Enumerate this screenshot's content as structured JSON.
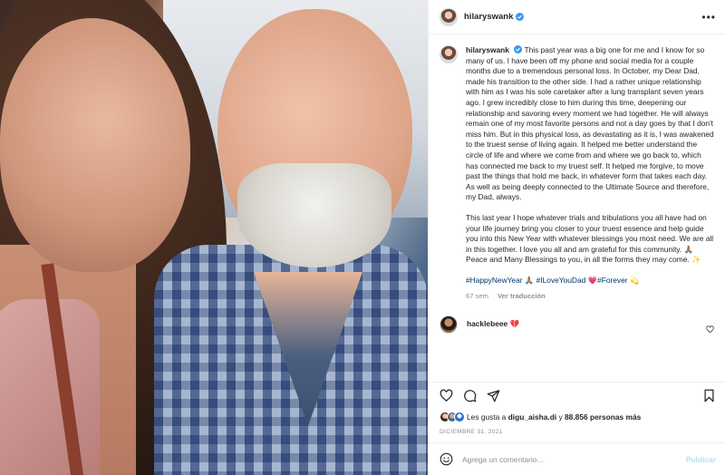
{
  "post": {
    "username": "hilaryswank",
    "more_label": "•••",
    "caption_paragraphs": [
      "This past year was a big one for me and I know for so many of us. I have been off my phone and social media for a couple months due to a tremendous personal loss. In October, my Dear Dad, made his transition to the other side. I had a rather unique relationship with him as I was his sole caretaker after a lung transplant seven years ago. I grew incredibly close to him during this time, deepening our relationship and savoring every moment we had together. He will always remain one of my most favorite persons and not a day goes by that I don't miss him. But in this physical loss, as devastating as it is, I was awakened to the truest sense of living again. It helped me better understand the circle of life and where we come from and where we go back to, which has connected me back to my truest self. It helped me forgive, to move past the things that hold me back, in whatever form that takes each day. As well as being deeply connected to the Ultimate Source and therefore, my Dad, always.",
      "This last year I hope whatever trials and tribulations you all have had on your life journey bring you closer to your truest essence and help guide you into this New Year with whatever blessings you most need. We are all in this together. I love you all and am grateful for this community. 🙏🏽",
      "Peace and Many Blessings to you, in all the forms they may come. ✨"
    ],
    "hashtags": [
      "#HappyNewYear",
      "🙏🏽",
      "#ILoveYouDad",
      "💗",
      "#Forever",
      "💫"
    ],
    "age": "67 sem",
    "translate_label": "Ver traducción"
  },
  "comment": {
    "username": "hacklebeee",
    "text": "💔"
  },
  "likes": {
    "prefix": "Les gusta a",
    "user": "digu_aisha.di",
    "middle": "y",
    "count": "88.856 personas más"
  },
  "date": "DICIEMBRE 31, 2021",
  "add_comment": {
    "placeholder": "Agrega un comentario...",
    "post_label": "Publicar"
  },
  "colors": {
    "link": "#00376b",
    "verified": "#3897f0",
    "muted": "#8e8e8e",
    "post_disabled": "#b2dffc"
  }
}
